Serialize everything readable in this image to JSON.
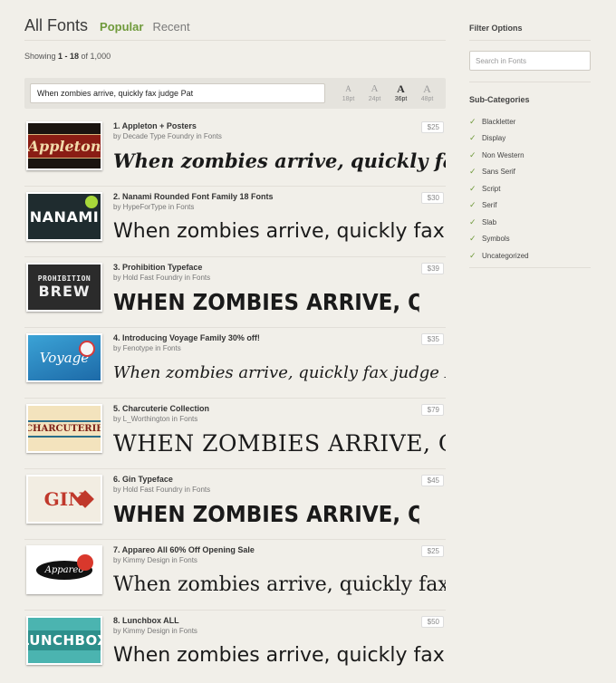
{
  "header": {
    "title": "All Fonts",
    "tabs": [
      "Popular",
      "Recent"
    ]
  },
  "results": {
    "prefix": "Showing ",
    "range": "1 - 18",
    "suffix": " of 1,000"
  },
  "preview": {
    "text": "When zombies arrive, quickly fax judge Pat",
    "sizes": [
      {
        "glyph": "A",
        "label": "18pt"
      },
      {
        "glyph": "A",
        "label": "24pt"
      },
      {
        "glyph": "A",
        "label": "36pt"
      },
      {
        "glyph": "A",
        "label": "48pt"
      }
    ],
    "selected_size": "36pt"
  },
  "fonts": [
    {
      "title": "1. Appleton + Posters",
      "byline": "by Decade Type Foundry in Fonts",
      "price": "$25",
      "thumb": "Appleton"
    },
    {
      "title": "2. Nanami Rounded Font Family 18 Fonts",
      "byline": "by HypeForType in Fonts",
      "price": "$30",
      "thumb": "NANAMI"
    },
    {
      "title": "3. Prohibition Typeface",
      "byline": "by Hold Fast Foundry in Fonts",
      "price": "$39",
      "thumb": "PROHIBITION",
      "thumb2": "BREW"
    },
    {
      "title": "4. Introducing Voyage Family 30% off!",
      "byline": "by Fenotype in Fonts",
      "price": "$35",
      "thumb": "Voyage"
    },
    {
      "title": "5. Charcuterie Collection",
      "byline": "by L_Worthington in Fonts",
      "price": "$79",
      "thumb": "CHARCUTERIE"
    },
    {
      "title": "6. Gin Typeface",
      "byline": "by Hold Fast Foundry in Fonts",
      "price": "$45",
      "thumb": "GIN"
    },
    {
      "title": "7. Appareo All 60% Off Opening Sale",
      "byline": "by Kimmy Design in Fonts",
      "price": "$25",
      "thumb": "Appareo"
    },
    {
      "title": "8. Lunchbox ALL",
      "byline": "by Kimmy Design in Fonts",
      "price": "$50",
      "thumb": "LUNCHBOX"
    }
  ],
  "sidebar": {
    "title": "Filter Options",
    "search_placeholder": "Search in Fonts",
    "subcategories_title": "Sub-Categories",
    "subcategories": [
      "Blackletter",
      "Display",
      "Non Western",
      "Sans Serif",
      "Script",
      "Serif",
      "Slab",
      "Symbols",
      "Uncategorized"
    ]
  }
}
